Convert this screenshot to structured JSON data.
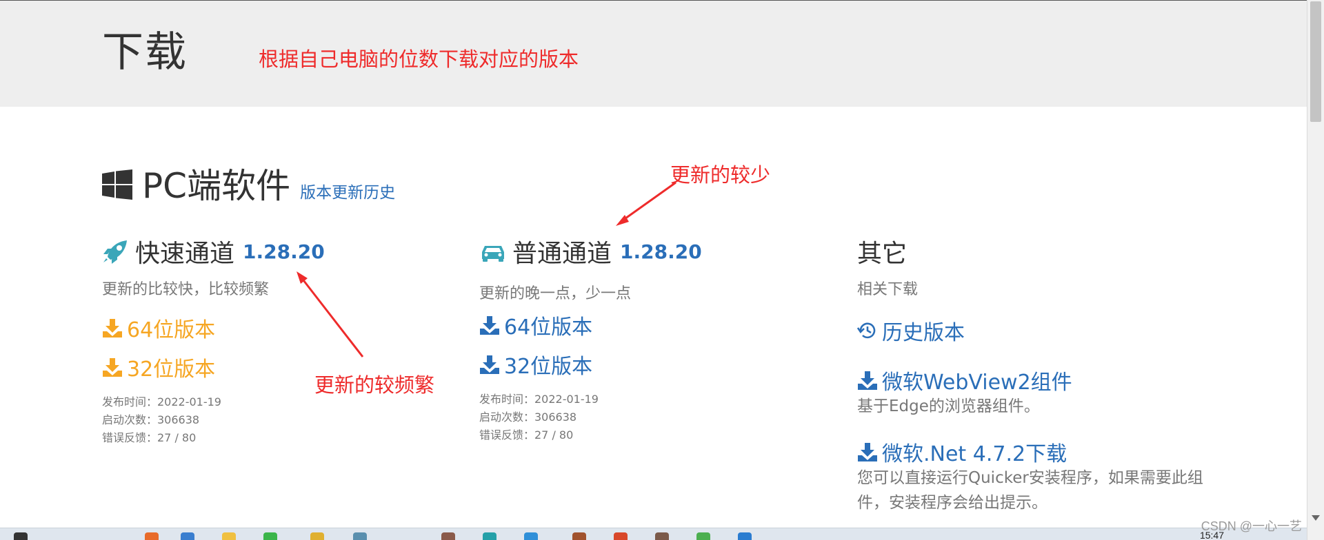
{
  "header": {
    "title": "下载",
    "note": "根据自己电脑的位数下载对应的版本"
  },
  "section": {
    "title": "PC端软件",
    "history_link": "版本更新历史"
  },
  "fast": {
    "title": "快速通道",
    "version": "1.28.20",
    "subtitle": "更新的比较快，比较频繁",
    "dl64": "64位版本",
    "dl32": "32位版本",
    "meta_release": "发布时间：2022-01-19",
    "meta_launches": "启动次数：306638",
    "meta_feedback": "错误反馈：27 / 80"
  },
  "normal": {
    "title": "普通通道",
    "version": "1.28.20",
    "subtitle": "更新的晚一点，少一点",
    "dl64": "64位版本",
    "dl32": "32位版本",
    "meta_release": "发布时间：2022-01-19",
    "meta_launches": "启动次数：306638",
    "meta_feedback": "错误反馈：27 / 80"
  },
  "other": {
    "title": "其它",
    "subtitle": "相关下载",
    "history": "历史版本",
    "webview": "微软WebView2组件",
    "webview_desc": "基于Edge的浏览器组件。",
    "dotnet": "微软.Net 4.7.2下载",
    "dotnet_desc": "您可以直接运行Quicker安装程序，如果需要此组件，安装程序会给出提示。"
  },
  "annotations": {
    "less_updates": "更新的较少",
    "frequent_updates": "更新的较频繁"
  },
  "taskbar": {
    "clock": "15:47"
  },
  "watermark": "CSDN @一心一艺",
  "colors": {
    "link_blue": "#2a6eb8",
    "fast_orange": "#f6a623",
    "annotation_red": "#ee2b2b",
    "icon_teal": "#3aa6b9"
  },
  "icons": {
    "windows": "windows-logo-icon",
    "fast": "rocket-icon",
    "normal": "car-icon",
    "download": "download-icon",
    "history": "history-icon"
  }
}
